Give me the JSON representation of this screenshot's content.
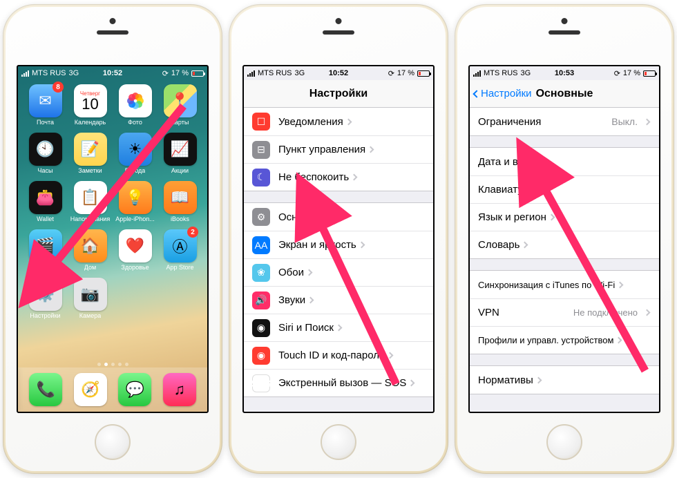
{
  "status": {
    "carrier": "MTS RUS",
    "network": "3G",
    "battery": "17 %",
    "time1": "10:52",
    "time2": "10:52",
    "time3": "10:53"
  },
  "home": {
    "calendar_weekday": "Четверг",
    "calendar_date": "10",
    "apps": {
      "mail": "Почта",
      "mail_badge": "8",
      "calendar": "Календарь",
      "photos": "Фото",
      "maps": "Карты",
      "clock": "Часы",
      "notes": "Заметки",
      "weather": "Погода",
      "stocks": "Акции",
      "wallet": "Wallet",
      "reminders": "Напоминания",
      "tips": "Apple-iPhon...",
      "ibooks": "iBooks",
      "videos": "Видео",
      "homeapp": "Дом",
      "health": "Здоровье",
      "appstore": "App Store",
      "appstore_badge": "2",
      "settings": "Настройки",
      "camera": "Камера"
    }
  },
  "settings_root": {
    "title": "Настройки",
    "rows": {
      "notifications": "Уведомления",
      "control_center": "Пункт управления",
      "dnd": "Не беспокоить",
      "general": "Основные",
      "display": "Экран и яркость",
      "wallpaper": "Обои",
      "sounds": "Звуки",
      "siri": "Siri и Поиск",
      "touchid": "Touch ID и код-пароль",
      "sos": "Экстренный вызов — SOS"
    }
  },
  "settings_general": {
    "back": "Настройки",
    "title": "Основные",
    "rows": {
      "restrictions": "Ограничения",
      "restrictions_detail": "Выкл.",
      "datetime": "Дата и время",
      "keyboard": "Клавиатура",
      "language": "Язык и регион",
      "dictionary": "Словарь",
      "itunes_wifi": "Синхронизация с iTunes по Wi-Fi",
      "vpn": "VPN",
      "vpn_detail": "Не подключено",
      "profiles": "Профили и управл. устройством",
      "regulatory": "Нормативы"
    }
  }
}
